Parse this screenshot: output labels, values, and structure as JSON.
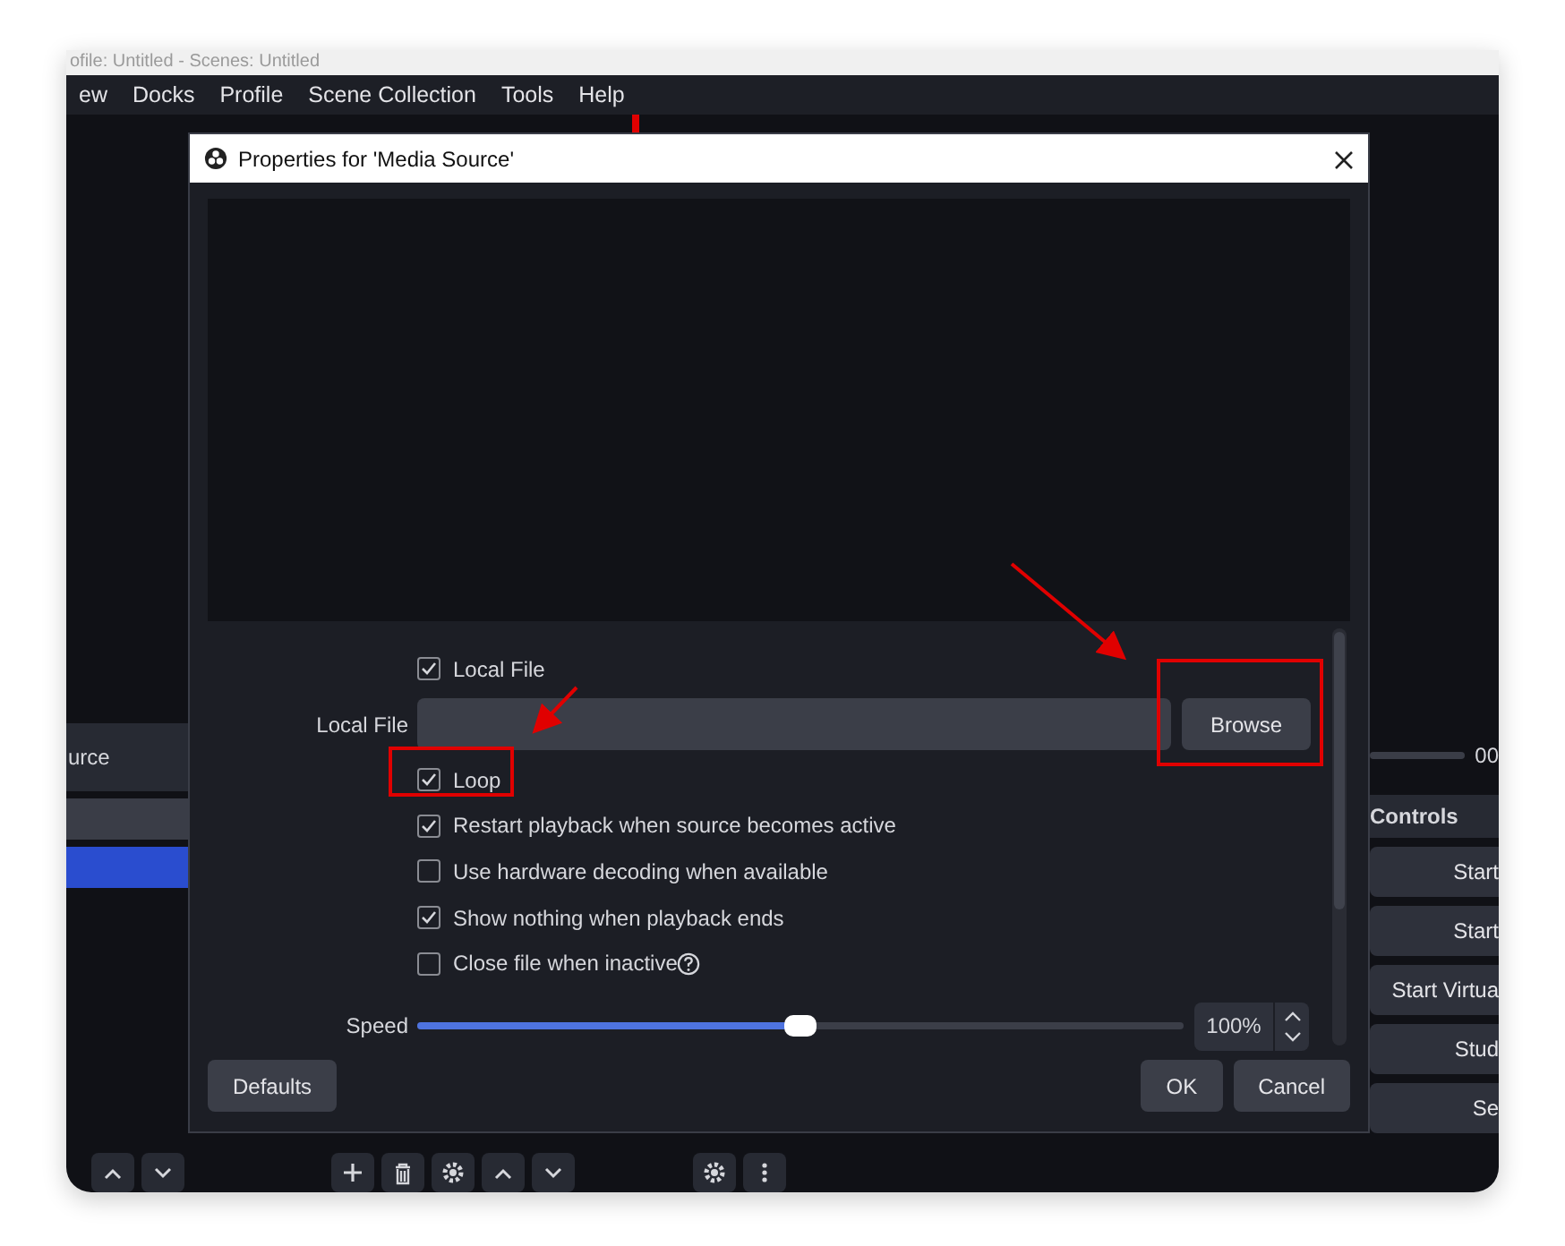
{
  "app": {
    "title": "ofile: Untitled - Scenes: Untitled",
    "menu": [
      "ew",
      "Docks",
      "Profile",
      "Scene Collection",
      "Tools",
      "Help"
    ],
    "source_label": "urce",
    "list_rows": [
      {
        "selected": false
      },
      {
        "selected": true
      }
    ],
    "seek": {
      "level": 0
    },
    "timer": "00",
    "controls_title": "Controls",
    "controls": [
      "Start",
      "Start",
      "Start Virtua",
      "Stud",
      "Se"
    ]
  },
  "dialog": {
    "title": "Properties for 'Media Source'",
    "properties": [
      {
        "kind": "checkbox",
        "label": "Local File",
        "checked": true,
        "help": false
      },
      {
        "kind": "file",
        "label": "Local File",
        "button": "Browse"
      },
      {
        "kind": "checkbox",
        "label": "Loop",
        "checked": true,
        "help": false
      },
      {
        "kind": "checkbox",
        "label": "Restart playback when source becomes active",
        "checked": true,
        "help": false
      },
      {
        "kind": "checkbox",
        "label": "Use hardware decoding when available",
        "checked": false,
        "help": false
      },
      {
        "kind": "checkbox",
        "label": "Show nothing when playback ends",
        "checked": true,
        "help": false
      },
      {
        "kind": "checkbox",
        "label": "Close file when inactive",
        "checked": false,
        "help": true
      },
      {
        "kind": "slider",
        "label": "Speed",
        "level": 0.5,
        "value": "100%"
      }
    ],
    "defaults": "Defaults",
    "ok": "OK",
    "cancel": "Cancel"
  }
}
